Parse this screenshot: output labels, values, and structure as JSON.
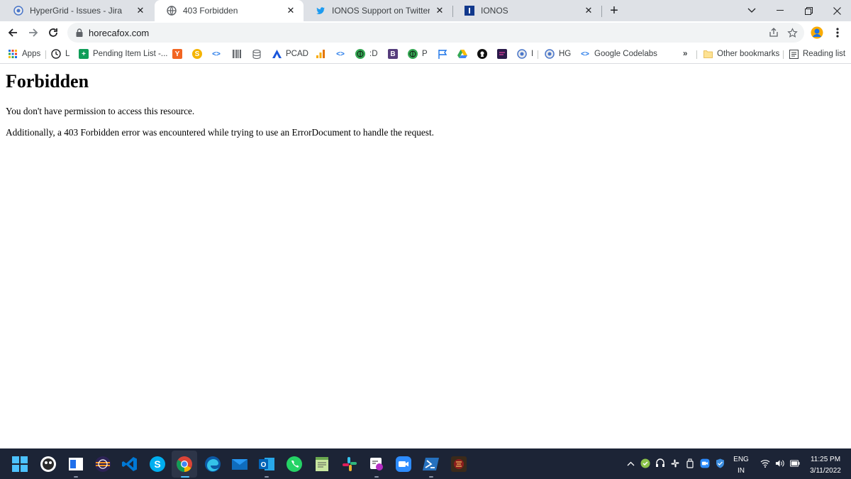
{
  "tabs": [
    {
      "title": "HyperGrid - Issues - Jira",
      "icon": "jira-icon",
      "active": false
    },
    {
      "title": "403 Forbidden",
      "icon": "globe-icon",
      "active": true
    },
    {
      "title": "IONOS Support on Twitter: \"@su",
      "icon": "twitter-icon",
      "active": false
    },
    {
      "title": "IONOS",
      "icon": "ionos-icon",
      "active": false
    }
  ],
  "new_tab_label": "+",
  "address_bar": {
    "url": "horecafox.com"
  },
  "bookmarks": {
    "apps": "Apps",
    "history_l": "L",
    "pending": "Pending Item List -...",
    "y_badge": "Y",
    "s_badge": "S",
    "code1": "<>",
    "pcad": "PCAD",
    "code2": "<>",
    "d_label": ":D",
    "b_badge": "B",
    "p_label": "P",
    "i_label": "I",
    "hg": "HG",
    "codelabs": "Google Codelabs",
    "more": "»",
    "other": "Other bookmarks",
    "reading": "Reading list"
  },
  "page": {
    "heading": "Forbidden",
    "line1": "You don't have permission to access this resource.",
    "line2": "Additionally, a 403 Forbidden error was encountered while trying to use an ErrorDocument to handle the request."
  },
  "taskbar": {
    "lang_top": "ENG",
    "lang_bottom": "IN",
    "time": "11:25 PM",
    "date": "3/11/2022",
    "tray_chevron": "^"
  },
  "colors": {
    "tabstrip": "#dee1e6",
    "taskbar": "#1c2436",
    "link_blue": "#1a73e8"
  }
}
